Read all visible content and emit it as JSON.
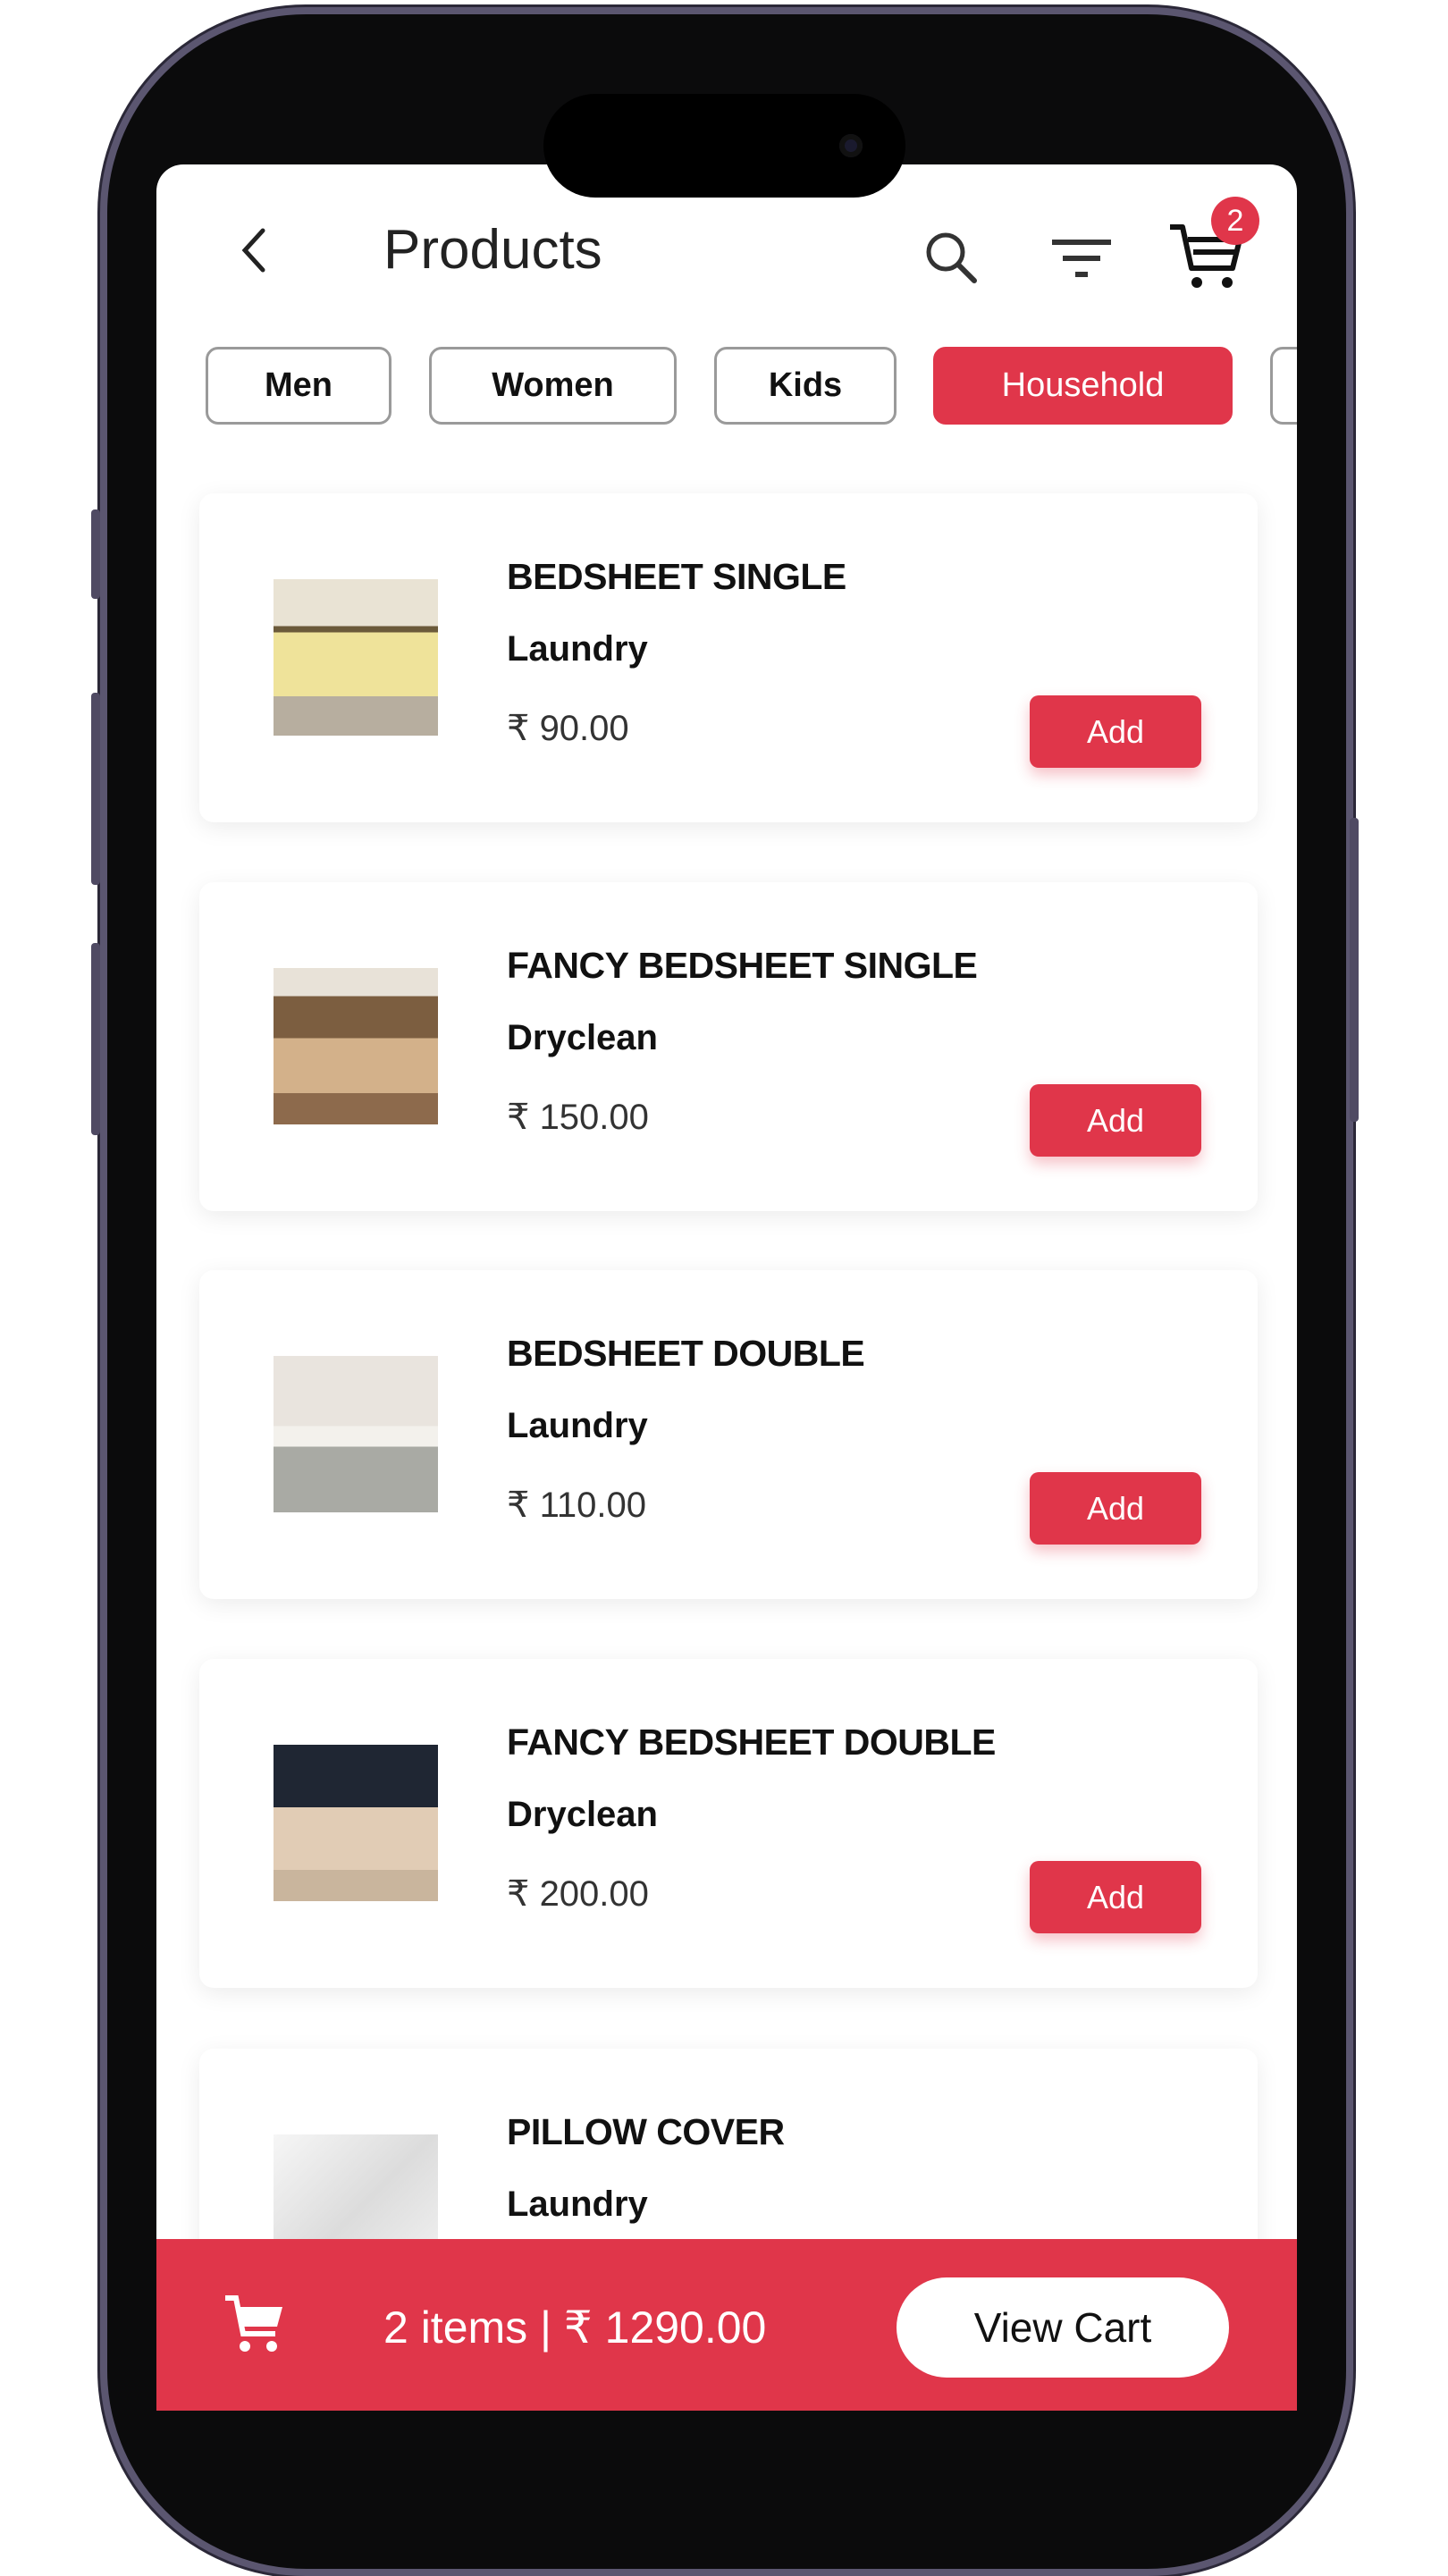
{
  "header": {
    "title": "Products",
    "back_icon": "chevron-left-icon",
    "search_icon": "search-icon",
    "filter_icon": "filter-icon",
    "cart_icon": "cart-icon",
    "cart_count": "2"
  },
  "categories": [
    {
      "label": "Men",
      "active": false
    },
    {
      "label": "Women",
      "active": false
    },
    {
      "label": "Kids",
      "active": false
    },
    {
      "label": "Household",
      "active": true
    }
  ],
  "products": [
    {
      "name": "BEDSHEET SINGLE",
      "service": "Laundry",
      "price": "₹  90.00",
      "add_label": "Add"
    },
    {
      "name": "FANCY BEDSHEET SINGLE",
      "service": "Dryclean",
      "price": "₹  150.00",
      "add_label": "Add"
    },
    {
      "name": "BEDSHEET DOUBLE",
      "service": "Laundry",
      "price": "₹  110.00",
      "add_label": "Add"
    },
    {
      "name": "FANCY BEDSHEET DOUBLE",
      "service": "Dryclean",
      "price": "₹  200.00",
      "add_label": "Add"
    },
    {
      "name": "PILLOW COVER",
      "service": "Laundry",
      "price": "",
      "add_label": ""
    }
  ],
  "cart_bar": {
    "summary": "2 items | ₹ 1290.00",
    "view_cart_label": "View Cart"
  },
  "colors": {
    "accent": "#e0364a"
  }
}
